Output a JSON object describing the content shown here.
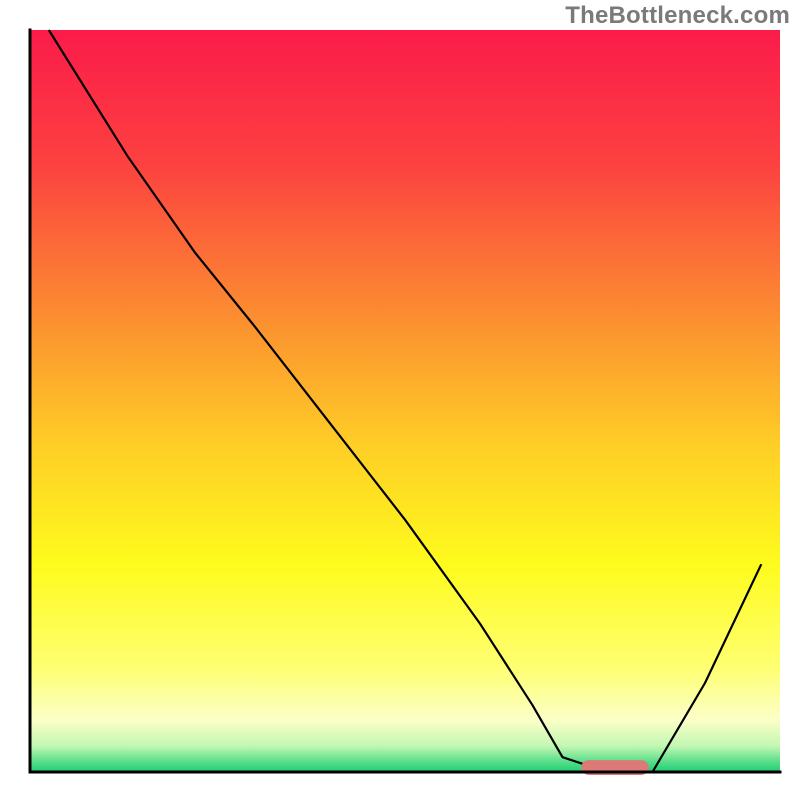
{
  "watermark": "TheBottleneck.com",
  "chart_data": {
    "type": "line",
    "title": "",
    "xlabel": "",
    "ylabel": "",
    "xlim": [
      0,
      100
    ],
    "ylim": [
      0,
      100
    ],
    "background": {
      "type": "vertical-gradient",
      "stops": [
        {
          "offset": 0.0,
          "color": "#fb1b4a"
        },
        {
          "offset": 0.18,
          "color": "#fc4140"
        },
        {
          "offset": 0.38,
          "color": "#fc8b31"
        },
        {
          "offset": 0.56,
          "color": "#fece26"
        },
        {
          "offset": 0.72,
          "color": "#fefb1d"
        },
        {
          "offset": 0.86,
          "color": "#feff72"
        },
        {
          "offset": 0.93,
          "color": "#fbffc7"
        },
        {
          "offset": 0.965,
          "color": "#c3f7b3"
        },
        {
          "offset": 0.985,
          "color": "#5ddf8c"
        },
        {
          "offset": 1.0,
          "color": "#1fcd73"
        }
      ]
    },
    "series": [
      {
        "name": "bottleneck-curve",
        "color": "#000000",
        "width": 2.2,
        "x": [
          2.5,
          13,
          22,
          30,
          40,
          50,
          60,
          67,
          71,
          77,
          83,
          90,
          97.5
        ],
        "y": [
          100,
          83,
          70,
          60,
          47,
          34,
          20,
          9,
          2,
          0,
          0,
          12,
          28
        ]
      }
    ],
    "marker": {
      "name": "optimal-range",
      "color": "#dd7a78",
      "x_start": 73.5,
      "x_end": 82.5,
      "y": 0.6,
      "thickness": 2.0
    },
    "axes": {
      "color": "#000000",
      "width": 3
    }
  }
}
